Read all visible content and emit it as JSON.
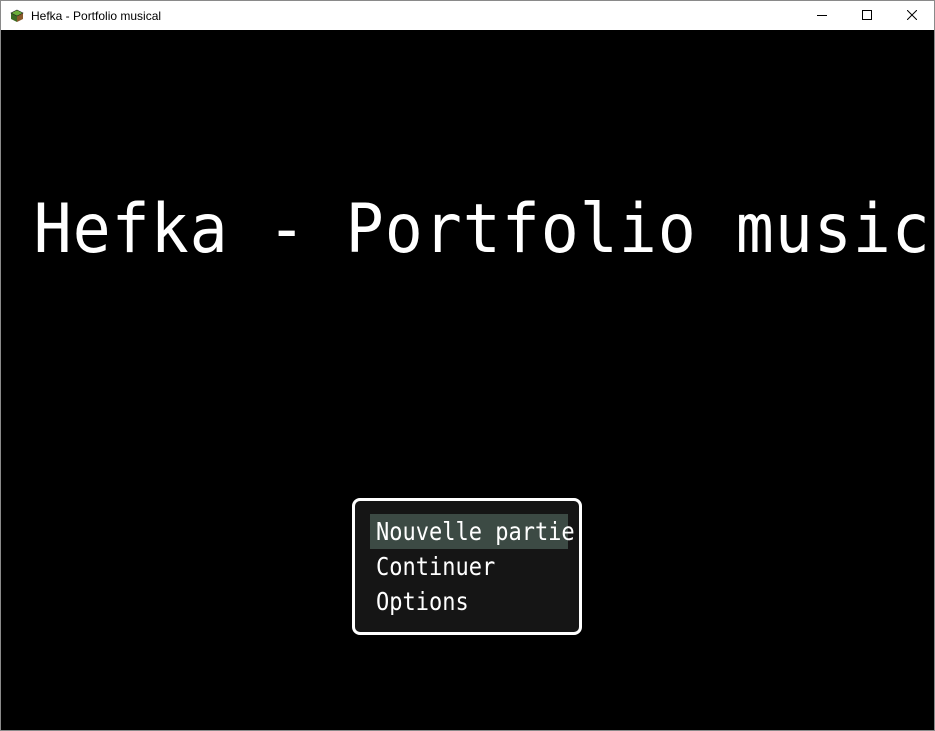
{
  "window": {
    "title": "Hefka - Portfolio musical",
    "icon": "game-cube-icon",
    "controls": {
      "minimize": "minimize-icon",
      "maximize": "maximize-icon",
      "close": "close-icon"
    }
  },
  "title_screen": {
    "title": "Hefka - Portfolio musical",
    "menu": {
      "selected_index": 0,
      "items": [
        {
          "label": "Nouvelle partie"
        },
        {
          "label": "Continuer"
        },
        {
          "label": "Options"
        }
      ]
    }
  },
  "colors": {
    "background": "#000000",
    "menu_background": "#151515",
    "menu_border": "#ffffff",
    "menu_highlight": "#3c4a44",
    "text": "#ffffff"
  }
}
